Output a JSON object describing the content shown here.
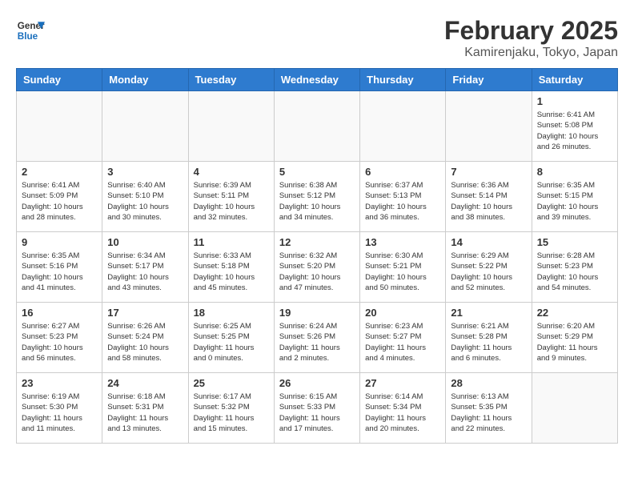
{
  "header": {
    "logo_line1": "General",
    "logo_line2": "Blue",
    "title": "February 2025",
    "subtitle": "Kamirenjaku, Tokyo, Japan"
  },
  "days_of_week": [
    "Sunday",
    "Monday",
    "Tuesday",
    "Wednesday",
    "Thursday",
    "Friday",
    "Saturday"
  ],
  "weeks": [
    [
      {
        "day": "",
        "info": ""
      },
      {
        "day": "",
        "info": ""
      },
      {
        "day": "",
        "info": ""
      },
      {
        "day": "",
        "info": ""
      },
      {
        "day": "",
        "info": ""
      },
      {
        "day": "",
        "info": ""
      },
      {
        "day": "1",
        "info": "Sunrise: 6:41 AM\nSunset: 5:08 PM\nDaylight: 10 hours and 26 minutes."
      }
    ],
    [
      {
        "day": "2",
        "info": "Sunrise: 6:41 AM\nSunset: 5:09 PM\nDaylight: 10 hours and 28 minutes."
      },
      {
        "day": "3",
        "info": "Sunrise: 6:40 AM\nSunset: 5:10 PM\nDaylight: 10 hours and 30 minutes."
      },
      {
        "day": "4",
        "info": "Sunrise: 6:39 AM\nSunset: 5:11 PM\nDaylight: 10 hours and 32 minutes."
      },
      {
        "day": "5",
        "info": "Sunrise: 6:38 AM\nSunset: 5:12 PM\nDaylight: 10 hours and 34 minutes."
      },
      {
        "day": "6",
        "info": "Sunrise: 6:37 AM\nSunset: 5:13 PM\nDaylight: 10 hours and 36 minutes."
      },
      {
        "day": "7",
        "info": "Sunrise: 6:36 AM\nSunset: 5:14 PM\nDaylight: 10 hours and 38 minutes."
      },
      {
        "day": "8",
        "info": "Sunrise: 6:35 AM\nSunset: 5:15 PM\nDaylight: 10 hours and 39 minutes."
      }
    ],
    [
      {
        "day": "9",
        "info": "Sunrise: 6:35 AM\nSunset: 5:16 PM\nDaylight: 10 hours and 41 minutes."
      },
      {
        "day": "10",
        "info": "Sunrise: 6:34 AM\nSunset: 5:17 PM\nDaylight: 10 hours and 43 minutes."
      },
      {
        "day": "11",
        "info": "Sunrise: 6:33 AM\nSunset: 5:18 PM\nDaylight: 10 hours and 45 minutes."
      },
      {
        "day": "12",
        "info": "Sunrise: 6:32 AM\nSunset: 5:20 PM\nDaylight: 10 hours and 47 minutes."
      },
      {
        "day": "13",
        "info": "Sunrise: 6:30 AM\nSunset: 5:21 PM\nDaylight: 10 hours and 50 minutes."
      },
      {
        "day": "14",
        "info": "Sunrise: 6:29 AM\nSunset: 5:22 PM\nDaylight: 10 hours and 52 minutes."
      },
      {
        "day": "15",
        "info": "Sunrise: 6:28 AM\nSunset: 5:23 PM\nDaylight: 10 hours and 54 minutes."
      }
    ],
    [
      {
        "day": "16",
        "info": "Sunrise: 6:27 AM\nSunset: 5:23 PM\nDaylight: 10 hours and 56 minutes."
      },
      {
        "day": "17",
        "info": "Sunrise: 6:26 AM\nSunset: 5:24 PM\nDaylight: 10 hours and 58 minutes."
      },
      {
        "day": "18",
        "info": "Sunrise: 6:25 AM\nSunset: 5:25 PM\nDaylight: 11 hours and 0 minutes."
      },
      {
        "day": "19",
        "info": "Sunrise: 6:24 AM\nSunset: 5:26 PM\nDaylight: 11 hours and 2 minutes."
      },
      {
        "day": "20",
        "info": "Sunrise: 6:23 AM\nSunset: 5:27 PM\nDaylight: 11 hours and 4 minutes."
      },
      {
        "day": "21",
        "info": "Sunrise: 6:21 AM\nSunset: 5:28 PM\nDaylight: 11 hours and 6 minutes."
      },
      {
        "day": "22",
        "info": "Sunrise: 6:20 AM\nSunset: 5:29 PM\nDaylight: 11 hours and 9 minutes."
      }
    ],
    [
      {
        "day": "23",
        "info": "Sunrise: 6:19 AM\nSunset: 5:30 PM\nDaylight: 11 hours and 11 minutes."
      },
      {
        "day": "24",
        "info": "Sunrise: 6:18 AM\nSunset: 5:31 PM\nDaylight: 11 hours and 13 minutes."
      },
      {
        "day": "25",
        "info": "Sunrise: 6:17 AM\nSunset: 5:32 PM\nDaylight: 11 hours and 15 minutes."
      },
      {
        "day": "26",
        "info": "Sunrise: 6:15 AM\nSunset: 5:33 PM\nDaylight: 11 hours and 17 minutes."
      },
      {
        "day": "27",
        "info": "Sunrise: 6:14 AM\nSunset: 5:34 PM\nDaylight: 11 hours and 20 minutes."
      },
      {
        "day": "28",
        "info": "Sunrise: 6:13 AM\nSunset: 5:35 PM\nDaylight: 11 hours and 22 minutes."
      },
      {
        "day": "",
        "info": ""
      }
    ]
  ]
}
